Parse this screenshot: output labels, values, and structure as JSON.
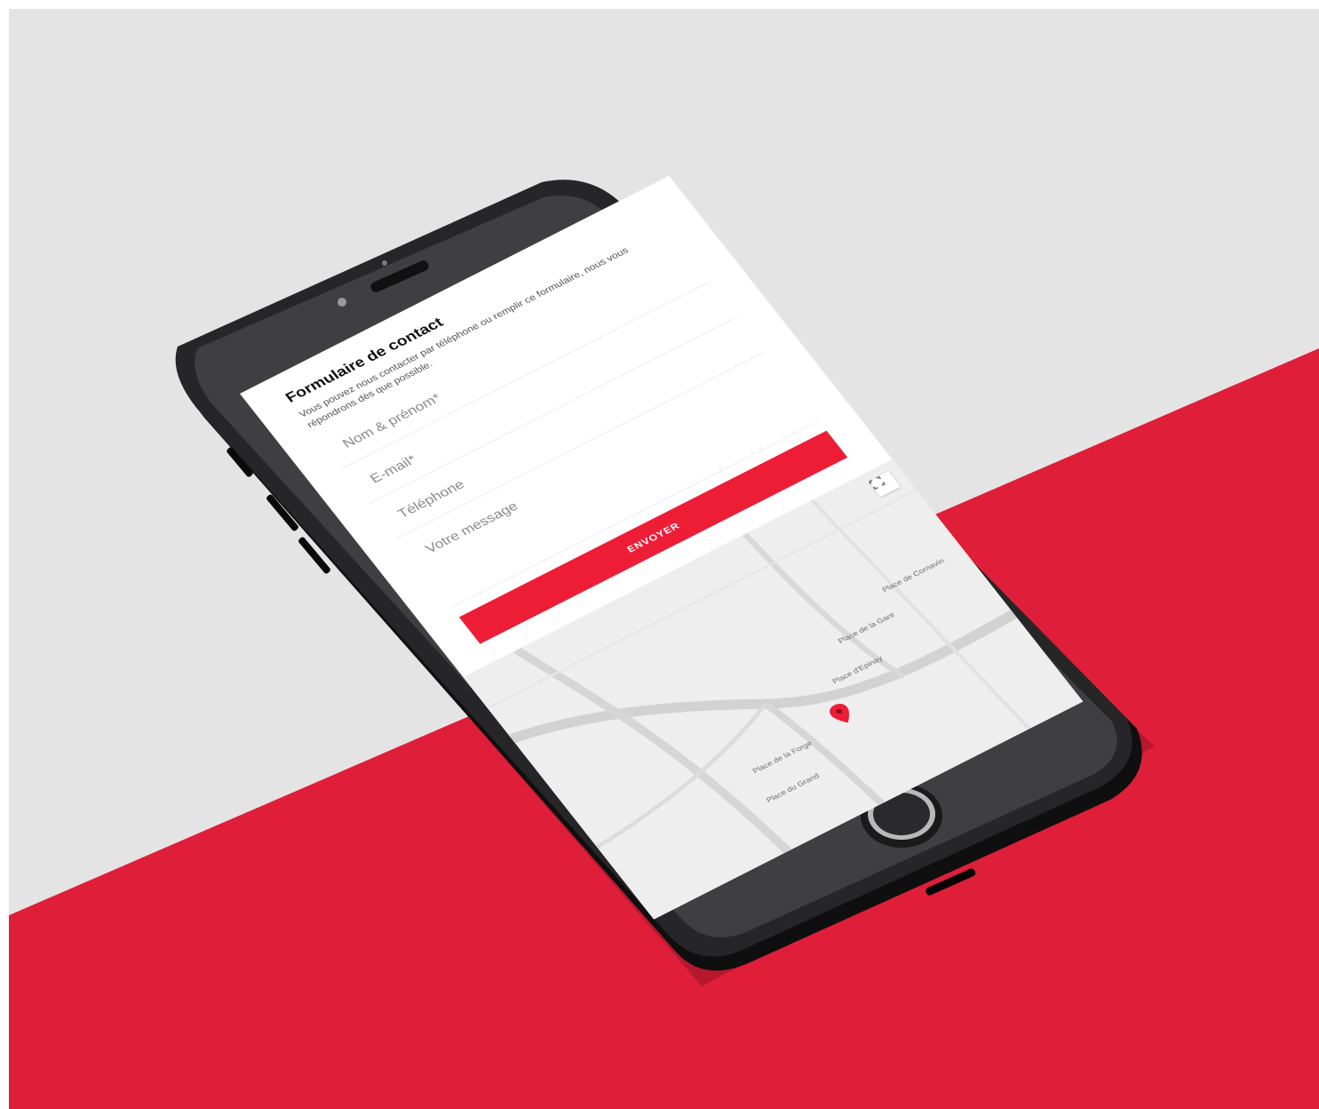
{
  "colors": {
    "accent": "#ee1d36",
    "surface_top": "#e5e5e6",
    "surface_bottom": "#e1203a",
    "phone_body": "#1b1b1d"
  },
  "contact_form": {
    "title": "Formulaire de contact",
    "intro": "Vous pouvez nous contacter par téléphone ou remplir ce formulaire, nous vous répondrons dès que possible.",
    "fields": {
      "name_placeholder": "Nom & prénom*",
      "email_placeholder": "E-mail*",
      "phone_placeholder": "Téléphone",
      "message_placeholder": "Votre message"
    },
    "submit_label": "ENVOYER"
  },
  "map": {
    "labels": {
      "place_1": "Place de la Gare",
      "place_2": "Place de Cornavin",
      "place_3": "Place d'Epinay",
      "place_4": "Place de la Forge",
      "place_5": "Place du Grand"
    },
    "icons": {
      "marker": "map-marker-icon",
      "fullscreen": "fullscreen-icon"
    }
  }
}
